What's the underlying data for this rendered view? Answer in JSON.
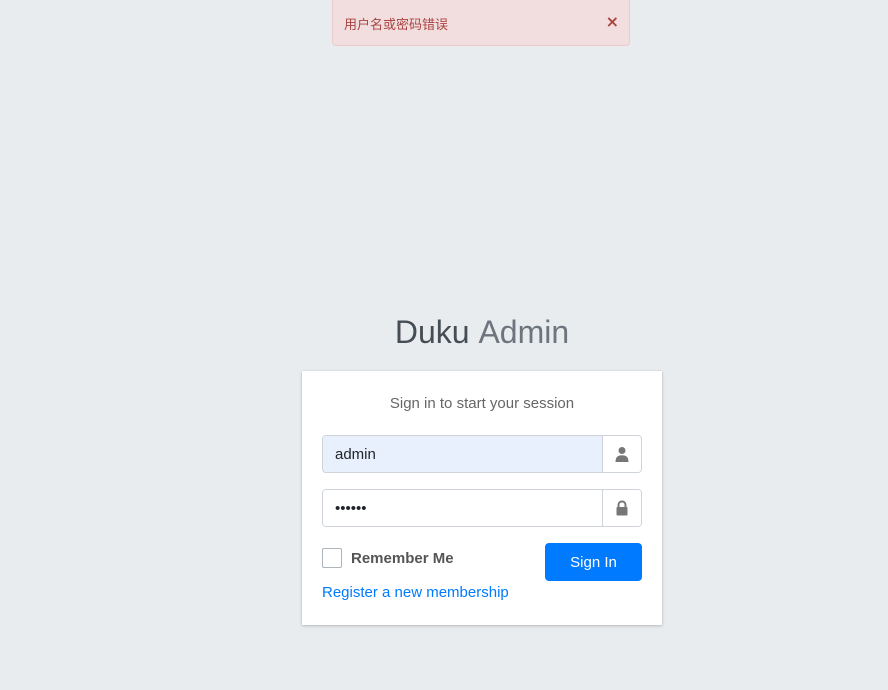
{
  "alert": {
    "message": "用户名或密码错误",
    "close_symbol": "×"
  },
  "logo": {
    "strong": "Duku",
    "light": "Admin"
  },
  "login": {
    "message": "Sign in to start your session",
    "username": {
      "value": "admin",
      "icon": "user-icon"
    },
    "password": {
      "value": "......",
      "icon": "lock-icon"
    },
    "remember_label": "Remember Me",
    "remember_checked": false,
    "signin_label": "Sign In",
    "register_label": "Register a new membership"
  },
  "colors": {
    "background": "#e9ecef",
    "primary": "#007bff",
    "alert_bg": "#f2dede",
    "alert_text": "#a94442",
    "autofill_bg": "#e8f0fe"
  }
}
